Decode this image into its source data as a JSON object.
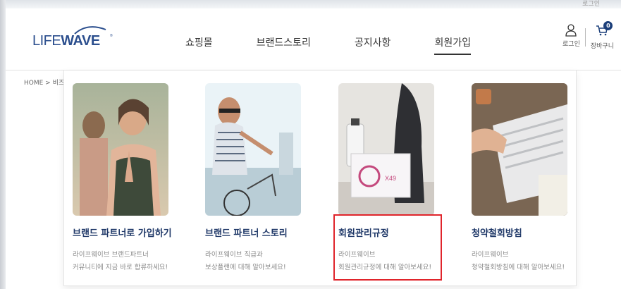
{
  "top_util": "로그인",
  "brand": {
    "logo_text": "LIFEWAVE",
    "accent_color": "#1c3f7a"
  },
  "nav": {
    "items": [
      {
        "label": "쇼핑몰"
      },
      {
        "label": "브랜드스토리"
      },
      {
        "label": "공지사항"
      },
      {
        "label": "회원가입",
        "active": true
      }
    ]
  },
  "user": {
    "login_label": "로그인",
    "cart_label": "장바구니",
    "cart_count": "0"
  },
  "breadcrumb": "HOME > 비즈니스",
  "mega_menu": {
    "cards": [
      {
        "title": "브랜드 파트너로 가입하기",
        "desc_line1": "라이프웨이브 브랜드파트너",
        "desc_line2": "커뮤니티에 지금 바로 합류하세요!"
      },
      {
        "title": "브랜드 파트너 스토리",
        "desc_line1": "라이프웨이브 직급과",
        "desc_line2": "보상플랜에 대해 알아보세요!"
      },
      {
        "title": "회원관리규정",
        "desc_line1": "라이프웨이브",
        "desc_line2": "회원관리규정에 대해 알아보세요!",
        "highlighted": true
      },
      {
        "title": "청약철회방침",
        "desc_line1": "라이프웨이브",
        "desc_line2": "청약철회방침에 대해 알아보세요!"
      }
    ]
  },
  "colors": {
    "highlight": "#e0242b",
    "title_navy": "#1f3868"
  }
}
